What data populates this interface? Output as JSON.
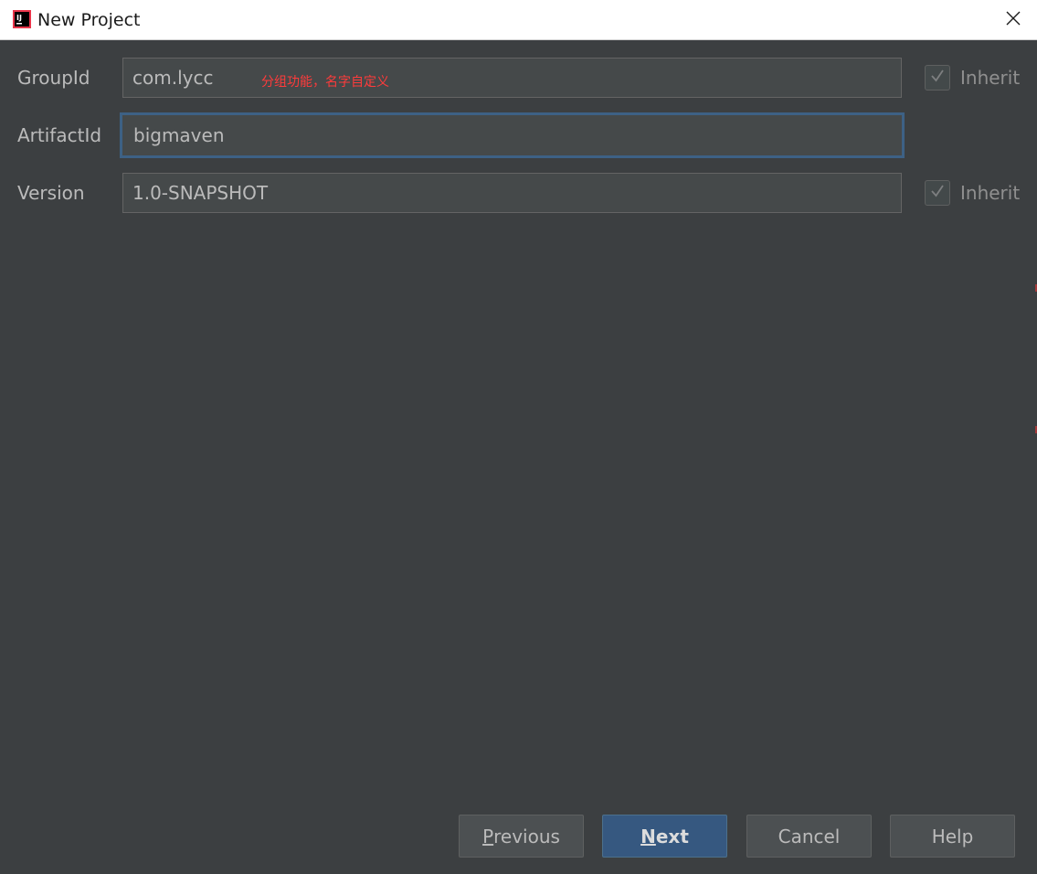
{
  "window": {
    "title": "New Project",
    "app_icon": "intellij-idea-icon",
    "close_icon": "close-icon"
  },
  "form": {
    "group_id": {
      "label": "GroupId",
      "value": "com.lycc",
      "hint": "分组功能，名字自定义",
      "inherit_label": "Inherit",
      "inherit_checked": true
    },
    "artifact_id": {
      "label": "ArtifactId",
      "value": "bigmaven"
    },
    "version": {
      "label": "Version",
      "value": "1.0-SNAPSHOT",
      "inherit_label": "Inherit",
      "inherit_checked": true
    }
  },
  "buttons": {
    "previous": {
      "mnemonic": "P",
      "rest": "revious"
    },
    "next": {
      "mnemonic": "N",
      "rest": "ext"
    },
    "cancel": "Cancel",
    "help": "Help"
  },
  "colors": {
    "background": "#3c3f41",
    "field_bg": "#45494a",
    "focus_border": "#3d6185",
    "primary_button": "#365880",
    "hint_text": "#ff3b3b"
  }
}
